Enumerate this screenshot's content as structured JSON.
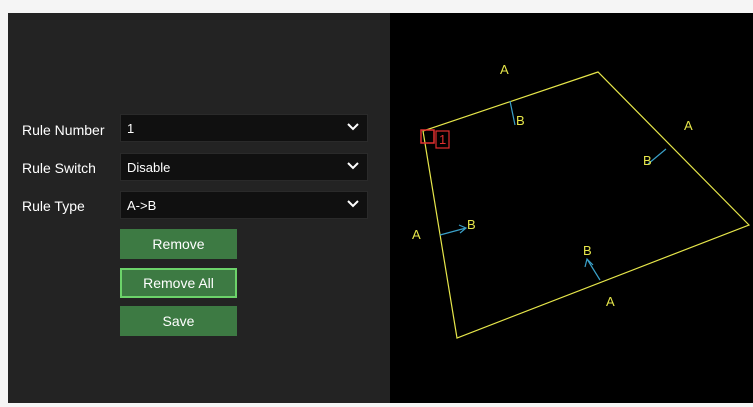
{
  "form": {
    "rule_number": {
      "label": "Rule Number",
      "value": "1"
    },
    "rule_switch": {
      "label": "Rule Switch",
      "value": "Disable"
    },
    "rule_type": {
      "label": "Rule Type",
      "value": "A->B"
    }
  },
  "buttons": {
    "remove": "Remove",
    "remove_all": "Remove All",
    "save": "Save"
  },
  "overlay": {
    "rule_index": "1",
    "side_a": "A",
    "side_b": "B"
  },
  "colors": {
    "region_line": "#e6e64a",
    "arrow": "#3aa0c8",
    "rule_marker": "#e03030",
    "button": "#3d7a43",
    "button_focus_border": "#6cd36a"
  }
}
